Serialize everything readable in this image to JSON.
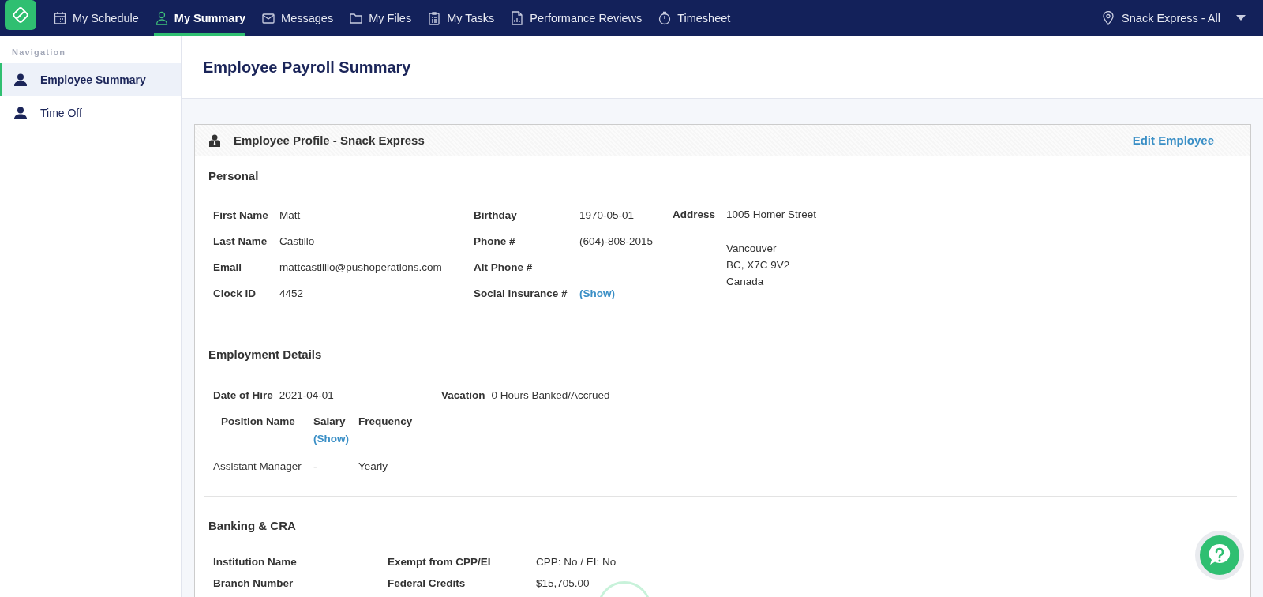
{
  "topbar": {
    "items": [
      {
        "label": "My Schedule",
        "selected": false
      },
      {
        "label": "My Summary",
        "selected": true
      },
      {
        "label": "Messages",
        "selected": false
      },
      {
        "label": "My Files",
        "selected": false
      },
      {
        "label": "My Tasks",
        "selected": false
      },
      {
        "label": "Performance Reviews",
        "selected": false
      },
      {
        "label": "Timesheet",
        "selected": false
      }
    ],
    "location": "Snack Express - All"
  },
  "sidebar": {
    "heading": "Navigation",
    "items": [
      {
        "label": "Employee Summary",
        "selected": true
      },
      {
        "label": "Time Off",
        "selected": false
      }
    ]
  },
  "page_title": "Employee Payroll Summary",
  "card": {
    "title": "Employee Profile - Snack Express",
    "edit_link": "Edit Employee",
    "personal": {
      "heading": "Personal",
      "columns": [
        [
          {
            "label": "First Name",
            "value": "Matt",
            "kind": "text"
          },
          {
            "label": "Last Name",
            "value": "Castillo",
            "kind": "text"
          },
          {
            "label": "Email",
            "value": "mattcastillio@pushoperations.com",
            "kind": "text"
          },
          {
            "label": "Clock ID",
            "value": "4452",
            "kind": "text"
          }
        ],
        [
          {
            "label": "Birthday",
            "value": "1970-05-01",
            "kind": "text"
          },
          {
            "label": "Phone #",
            "value": "(604)-808-2015",
            "kind": "text"
          },
          {
            "label": "Alt Phone #",
            "kind": "text"
          },
          {
            "label": "Social Insurance #",
            "value": "(Show)",
            "kind": "link"
          }
        ]
      ],
      "address": {
        "label": "Address",
        "street": "1005 Homer Street",
        "lines": [
          "Vancouver",
          "BC, X7C 9V2",
          "Canada"
        ]
      }
    },
    "employment": {
      "heading": "Employment Details",
      "fields": [
        {
          "label": "Date of Hire",
          "value": "2021-04-01"
        },
        {
          "label": "Vacation",
          "value": "0 Hours Banked/Accrued"
        }
      ],
      "positions": {
        "columns": [
          {
            "label": "Position Name"
          },
          {
            "label": "Salary",
            "link": "(Show)"
          },
          {
            "label": "Frequency"
          }
        ],
        "rows": [
          [
            "Assistant Manager",
            "-",
            "Yearly"
          ]
        ]
      }
    },
    "banking": {
      "heading": "Banking & CRA",
      "rows": [
        {
          "label": "Institution Name",
          "label_2": "Exempt from CPP/EI",
          "value_2": "CPP: No / EI: No"
        },
        {
          "label": "Branch Number",
          "label_2": "Federal Credits",
          "value_2": "$15,705.00"
        }
      ]
    }
  }
}
